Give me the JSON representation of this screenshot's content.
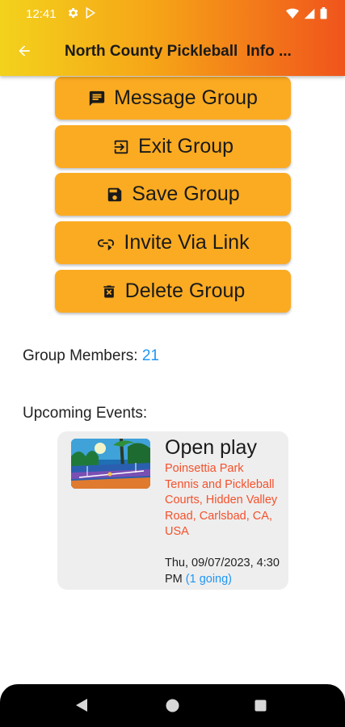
{
  "status_bar": {
    "time": "12:41",
    "left_icons": [
      "gear-icon",
      "play-store-icon"
    ],
    "right_icons": [
      "wifi-icon",
      "signal-icon",
      "battery-icon"
    ]
  },
  "app_bar": {
    "back_icon": "arrow-left-icon",
    "title": "North County Pickleball  Info ..."
  },
  "actions": [
    {
      "label": "Message Group",
      "icon": "message-icon"
    },
    {
      "label": "Exit Group",
      "icon": "exit-icon"
    },
    {
      "label": "Save Group",
      "icon": "save-icon"
    },
    {
      "label": "Invite Via Link",
      "icon": "link-icon"
    },
    {
      "label": "Delete Group",
      "icon": "delete-icon"
    }
  ],
  "members": {
    "label": "Group Members:",
    "count": "21"
  },
  "upcoming": {
    "label": "Upcoming Events:",
    "events": [
      {
        "title": "Open play",
        "location": "Poinsettia Park Tennis and Pickleball Courts, Hidden Valley Road, Carlsbad, CA, USA",
        "date": "Thu, 09/07/2023, 4:30 PM",
        "going": "(1 going)"
      }
    ]
  },
  "colors": {
    "button": "#fbab22",
    "accent_blue": "#2196f3",
    "location_red": "#f4512c",
    "header_start": "#f3d21c",
    "header_end": "#f0541c"
  },
  "nav_bar": {
    "icons": [
      "back-triangle-icon",
      "home-circle-icon",
      "recents-square-icon"
    ]
  }
}
